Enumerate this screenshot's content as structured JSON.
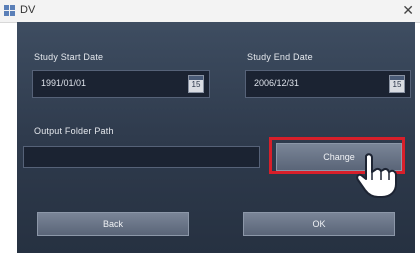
{
  "window": {
    "title": "DV",
    "close": "✕"
  },
  "form": {
    "start_label": "Study Start Date",
    "start_value": "1991/01/01",
    "end_label": "Study End Date",
    "end_value": "2006/12/31",
    "folder_label": "Output Folder Path",
    "folder_value": "",
    "calendar_glyph": "15",
    "change_label": "Change"
  },
  "buttons": {
    "left_label": "Back",
    "right_label": "OK"
  },
  "colors": {
    "highlight": "#d81f2a",
    "panel": "#2f3b4d"
  },
  "icons": [
    "app-icon",
    "calendar-icon",
    "pointing-hand-icon",
    "close-icon"
  ]
}
